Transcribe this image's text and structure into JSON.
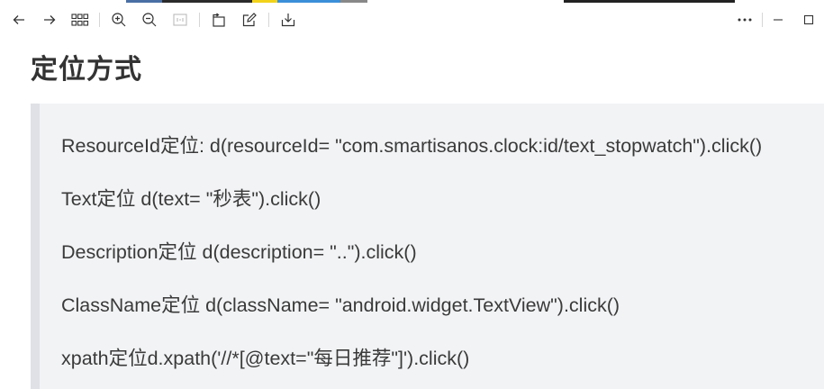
{
  "heading": "定位方式",
  "lines": [
    "ResourceId定位: d(resourceId= \"com.smartisanos.clock:id/text_stopwatch\").click()",
    "Text定位 d(text= \"秒表\").click()",
    "Description定位 d(description= \"..\").click()",
    "ClassName定位 d(className= \"android.widget.TextView\").click()",
    "xpath定位d.xpath('//*[@text=\"每日推荐\"]').click()"
  ],
  "toolbar": {
    "icons": [
      "back-arrow-icon",
      "forward-arrow-icon",
      "grid-icon",
      "zoom-in-icon",
      "zoom-out-icon",
      "fit-page-icon",
      "rotate-icon",
      "edit-icon",
      "download-icon",
      "more-icon",
      "minimize-icon",
      "maximize-icon"
    ]
  },
  "colors": {
    "quote_bg": "#f2f3f5",
    "quote_border": "#dfe1e6",
    "text": "#3a3a3a",
    "heading": "#333333"
  }
}
